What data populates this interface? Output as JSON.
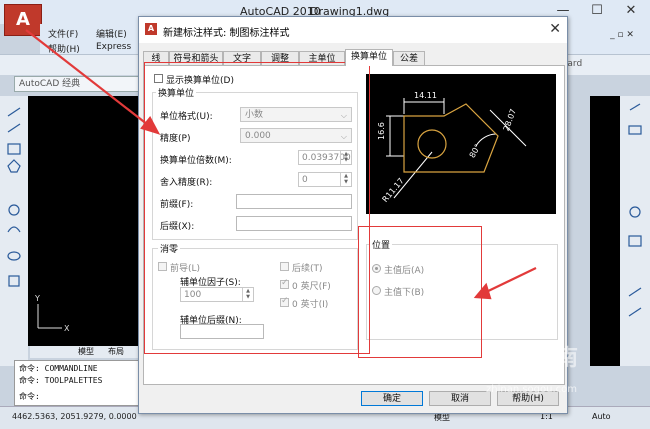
{
  "app": {
    "title": "AutoCAD 2010",
    "document": "Drawing1.dwg",
    "logo_letter": "A",
    "menu": [
      "文件(F)",
      "编辑(E)",
      "帮助(H)",
      "Express"
    ],
    "workspace": "AutoCAD 经典",
    "standard_label": "ndard",
    "model_tabs": [
      "模型",
      "布局"
    ],
    "command_lines": [
      "命令: COMMANDLINE",
      "命令: TOOLPALETTES",
      "命令:"
    ],
    "coordinates": "4462.5363, 2051.9279, 0.0000",
    "status_model": "模型",
    "status_scale": "1:1",
    "status_auto": "Auto",
    "watermark": "搜狗指南",
    "watermark_url": "zhinan.sogou.com"
  },
  "dialog": {
    "title": "新建标注样式: 制图标注样式",
    "tabs": [
      {
        "label": "线",
        "active": false
      },
      {
        "label": "符号和箭头",
        "active": false
      },
      {
        "label": "文字",
        "active": false
      },
      {
        "label": "调整",
        "active": false
      },
      {
        "label": "主单位",
        "active": false
      },
      {
        "label": "换算单位",
        "active": true
      },
      {
        "label": "公差",
        "active": false
      }
    ],
    "show_alt_units": "显示换算单位(D)",
    "alt_units_group": "换算单位",
    "unit_format_label": "单位格式(U):",
    "unit_format_value": "小数",
    "precision_label": "精度(P)",
    "precision_value": "0.000",
    "multiplier_label": "换算单位倍数(M):",
    "multiplier_value": "0.0393700",
    "round_label": "舍入精度(R):",
    "round_value": "0",
    "prefix_label": "前缀(F):",
    "suffix_label": "后缀(X):",
    "zero_group": "消零",
    "leading_label": "前导(L)",
    "sub_factor_label": "辅单位因子(S):",
    "sub_factor_value": "100",
    "sub_suffix_label": "辅单位后缀(N):",
    "trailing_label": "后续(T)",
    "feet_label": "0 英尺(F)",
    "inches_label": "0 英寸(I)",
    "placement_group": "位置",
    "after_primary": "主值后(A)",
    "below_primary": "主值下(B)",
    "ok": "确定",
    "cancel": "取消",
    "help": "帮助(H)",
    "preview_dims": [
      "14.11",
      "16.6",
      "28.07",
      "80°",
      "R11.17"
    ]
  },
  "colors": {
    "accent_red": "#e23a3a",
    "preview_bg": "#000000",
    "preview_lines": "#ffffff",
    "preview_shape": "#d9a441"
  }
}
